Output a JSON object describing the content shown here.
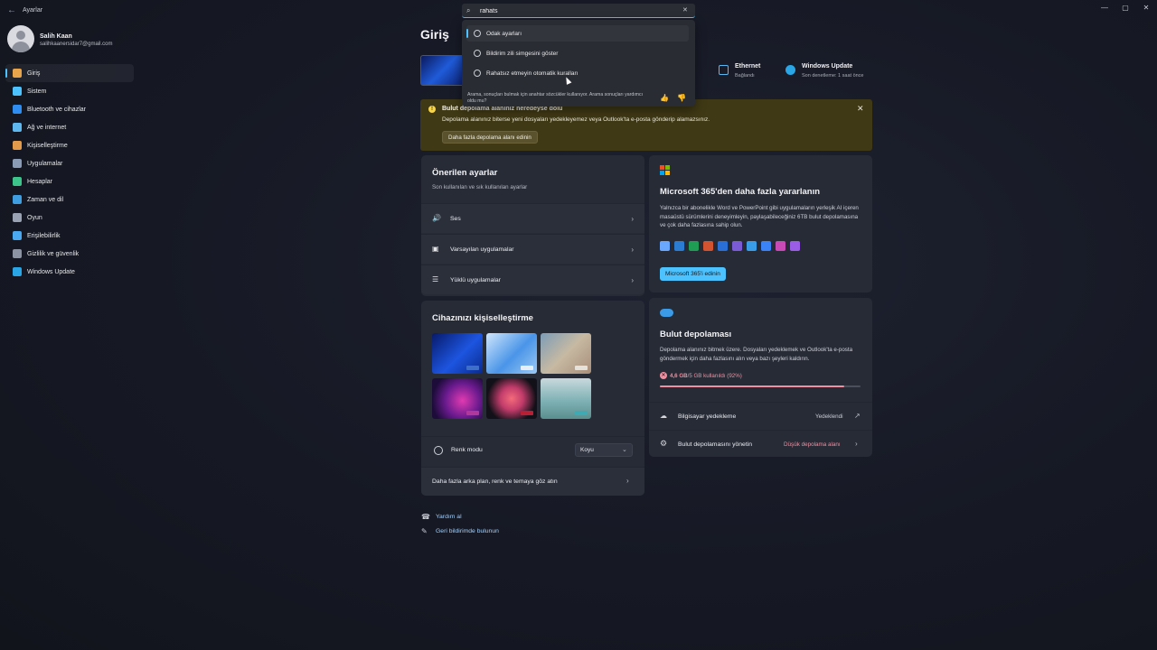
{
  "window": {
    "title": "Ayarlar",
    "back_glyph": "←",
    "minimize_glyph": "—",
    "maximize_glyph": "▢",
    "close_glyph": "✕"
  },
  "user": {
    "name": "Salih Kaan",
    "email": "salihkaanersidar7@gmail.com"
  },
  "sidebar": {
    "items": [
      {
        "label": "Giriş",
        "icon": "home-icon",
        "color": "#e8a44b",
        "active": true
      },
      {
        "label": "Sistem",
        "icon": "system-icon",
        "color": "#4cc2ff"
      },
      {
        "label": "Bluetooth ve cihazlar",
        "icon": "bluetooth-icon",
        "color": "#2f8cf0"
      },
      {
        "label": "Ağ ve internet",
        "icon": "wifi-icon",
        "color": "#5fb7ef"
      },
      {
        "label": "Kişiselleştirme",
        "icon": "brush-icon",
        "color": "#e39a4a"
      },
      {
        "label": "Uygulamalar",
        "icon": "apps-icon",
        "color": "#8a9bb5"
      },
      {
        "label": "Hesaplar",
        "icon": "person-icon",
        "color": "#3cc48a"
      },
      {
        "label": "Zaman ve dil",
        "icon": "globe-clock-icon",
        "color": "#3f9ee0"
      },
      {
        "label": "Oyun",
        "icon": "gamepad-icon",
        "color": "#9aa3b3"
      },
      {
        "label": "Erişilebilirlik",
        "icon": "accessibility-icon",
        "color": "#4aa8f0"
      },
      {
        "label": "Gizlilik ve güvenlik",
        "icon": "shield-icon",
        "color": "#8c93a3"
      },
      {
        "label": "Windows Update",
        "icon": "update-icon",
        "color": "#2aa6e6"
      }
    ]
  },
  "page": {
    "title": "Giriş"
  },
  "status": {
    "ethernet_title": "Ethernet",
    "ethernet_sub": "Bağlandı",
    "update_title": "Windows Update",
    "update_sub": "Son denetleme: 1 saat önce"
  },
  "search": {
    "value": "rahats",
    "icon": "search-icon",
    "clear_glyph": "✕",
    "results": [
      {
        "label": "Odak ayarları",
        "icon": "focus-icon"
      },
      {
        "label": "Bildirim zili simgesini göster",
        "icon": "bell-icon"
      },
      {
        "label": "Rahatsız etmeyin otomatik kuralları",
        "icon": "bell-icon"
      }
    ],
    "feedback_text": "Arama, sonuçları bulmak için anahtar sözcükler kullanıyor. Arama sonuçları yardımcı oldu mu?",
    "thumb_up": "👍",
    "thumb_down": "👎"
  },
  "banner": {
    "title": "Bulut depolama alanınız neredeyse dolu",
    "text": "Depolama alanınız biterse yeni dosyaları yedekleyemez veya Outlook'ta e-posta gönderip alamazsınız.",
    "button": "Daha fazla depolama alanı edinin",
    "close_glyph": "✕",
    "warn_glyph": "!"
  },
  "recommended": {
    "title": "Önerilen ayarlar",
    "subtitle": "Son kullanılan ve sık kullanılan ayarlar",
    "rows": [
      {
        "label": "Ses",
        "icon": "speaker-icon",
        "glyph": "🔊"
      },
      {
        "label": "Varsayılan uygulamalar",
        "icon": "default-apps-icon",
        "glyph": "▣"
      },
      {
        "label": "Yüklü uygulamalar",
        "icon": "installed-apps-icon",
        "glyph": "☰"
      }
    ],
    "chevron": "›"
  },
  "personalize": {
    "title": "Cihazınızı kişiselleştirme",
    "color_mode_label": "Renk modu",
    "color_mode_value": "Koyu",
    "more_link": "Daha fazla arka plan, renk ve temaya göz atın",
    "chevron": "›"
  },
  "m365": {
    "title": "Microsoft 365'den daha fazla yararlanın",
    "text": "Yalnızca bir abonelikle Word ve PowerPoint gibi uygulamaların yerleşik AI içeren masaüstü sürümlerini deneyimleyin, paylaşabileceğiniz 6TB bulut depolamasına ve çok daha fazlasına sahip olun.",
    "button": "Microsoft 365'i edinin",
    "app_icons": [
      "copilot-icon",
      "word-icon",
      "excel-icon",
      "powerpoint-icon",
      "outlook-icon",
      "teams-icon",
      "onedrive-icon",
      "defender-icon",
      "designer-icon",
      "clipchamp-icon"
    ],
    "app_colors": [
      "#6aa7ff",
      "#2b7cd3",
      "#1f9d55",
      "#d35230",
      "#2a6fd6",
      "#7b5cd6",
      "#3a9de8",
      "#3b82f6",
      "#c84bb5",
      "#9b5de5"
    ]
  },
  "cloud": {
    "title": "Bulut depolaması",
    "text": "Depolama alanınız bitmek üzere. Dosyaları yedeklemek ve Outlook'ta e-posta göndermek için daha fazlasını alın veya bazı şeyleri kaldırın.",
    "usage_bold": "4,6 GB",
    "usage_rest": "/5 GB kullanıldı (92%)",
    "usage_fraction": 0.92,
    "backup_label": "Bilgisayar yedekleme",
    "backup_status": "Yedeklendi",
    "manage_label": "Bulut depolamasını yönetin",
    "manage_status": "Düşük depolama alanı",
    "chevron": "›"
  },
  "footer": {
    "help": "Yardım al",
    "feedback": "Geri bildirimde bulunun"
  }
}
